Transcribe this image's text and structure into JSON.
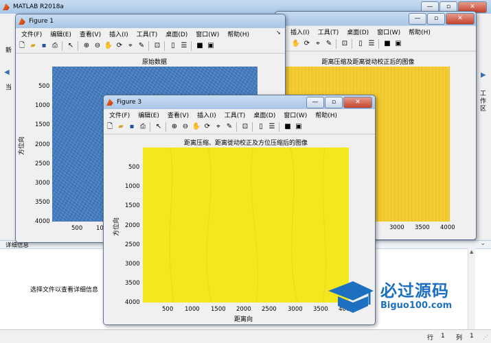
{
  "matlab": {
    "title": "MATLAB R2018a",
    "side_left_label": "当",
    "side_left_label2": "新",
    "side_right_label": "工作区",
    "details_title": "详细信息",
    "details_text": "选择文件以查看详细信息",
    "status_row_label": "行",
    "status_row_value": "1",
    "status_col_label": "列",
    "status_col_value": "1"
  },
  "menus": [
    "文件(F)",
    "编辑(E)",
    "查看(V)",
    "插入(I)",
    "工具(T)",
    "桌面(D)",
    "窗口(W)",
    "帮助(H)"
  ],
  "fig1": {
    "title": "Figure 1",
    "plot_title": "原始数据",
    "ylabel": "方位向",
    "yticks": [
      "500",
      "1000",
      "1500",
      "2000",
      "2500",
      "3000",
      "3500",
      "4000"
    ],
    "xticks": [
      "500",
      "10"
    ]
  },
  "fig2": {
    "plot_title": "距离压缩及距离徙动校正后的图像",
    "xticks": [
      "3000",
      "3500",
      "4000"
    ]
  },
  "fig3": {
    "title": "Figure 3",
    "plot_title": "距离压缩、距离徙动校正及方位压缩后的图像",
    "ylabel": "方位向",
    "xlabel": "距离向",
    "yticks": [
      "500",
      "1000",
      "1500",
      "2000",
      "2500",
      "3000",
      "3500",
      "4000"
    ],
    "xticks": [
      "500",
      "1000",
      "1500",
      "2000",
      "2500",
      "3000",
      "3500",
      "4000"
    ]
  },
  "watermark": {
    "brand": "必过源码",
    "url": "Biguo100.com"
  },
  "colors": {
    "noise_blue": "#3d6fc4",
    "image_yellow": "#f2e81d",
    "image_orange_yellow": "#f2c62a"
  }
}
